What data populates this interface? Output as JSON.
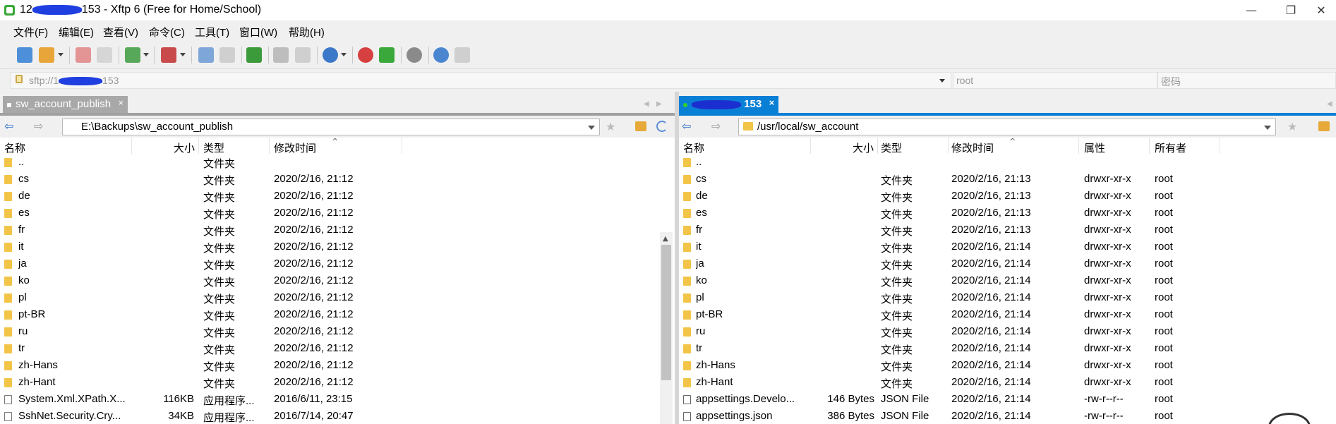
{
  "window": {
    "title_prefix": "12",
    "title_suffix": "153 - Xftp 6 (Free for Home/School)",
    "minimize_glyph": "—",
    "maximize_glyph": "❐",
    "close_glyph": "✕"
  },
  "menu": [
    "文件(F)",
    "编辑(E)",
    "查看(V)",
    "命令(C)",
    "工具(T)",
    "窗口(W)",
    "帮助(H)"
  ],
  "toolbar_icons": [
    "new-session-icon",
    "open-folder-icon",
    "connect-icon",
    "disconnect-icon",
    "new-window-icon",
    "media-icon",
    "sync-icon",
    "copy-icon",
    "transfer-icon",
    "globe-icon",
    "xshell-icon",
    "xftp-icon",
    "settings-icon",
    "help-icon",
    "message-icon"
  ],
  "address": {
    "prefix": "sftp://1",
    "suffix": "153",
    "user_placeholder": "root",
    "password_placeholder": "密码"
  },
  "left": {
    "tab_label": "sw_account_publish",
    "tab_close": "×",
    "path": "E:\\Backups\\sw_account_publish",
    "columns": {
      "name": "名称",
      "size": "大小",
      "type": "类型",
      "modified": "修改时间"
    },
    "rows": [
      {
        "icon": "folder",
        "name": "..",
        "size": "",
        "type": "文件夹",
        "modified": ""
      },
      {
        "icon": "folder",
        "name": "cs",
        "size": "",
        "type": "文件夹",
        "modified": "2020/2/16, 21:12"
      },
      {
        "icon": "folder",
        "name": "de",
        "size": "",
        "type": "文件夹",
        "modified": "2020/2/16, 21:12"
      },
      {
        "icon": "folder",
        "name": "es",
        "size": "",
        "type": "文件夹",
        "modified": "2020/2/16, 21:12"
      },
      {
        "icon": "folder",
        "name": "fr",
        "size": "",
        "type": "文件夹",
        "modified": "2020/2/16, 21:12"
      },
      {
        "icon": "folder",
        "name": "it",
        "size": "",
        "type": "文件夹",
        "modified": "2020/2/16, 21:12"
      },
      {
        "icon": "folder",
        "name": "ja",
        "size": "",
        "type": "文件夹",
        "modified": "2020/2/16, 21:12"
      },
      {
        "icon": "folder",
        "name": "ko",
        "size": "",
        "type": "文件夹",
        "modified": "2020/2/16, 21:12"
      },
      {
        "icon": "folder",
        "name": "pl",
        "size": "",
        "type": "文件夹",
        "modified": "2020/2/16, 21:12"
      },
      {
        "icon": "folder",
        "name": "pt-BR",
        "size": "",
        "type": "文件夹",
        "modified": "2020/2/16, 21:12"
      },
      {
        "icon": "folder",
        "name": "ru",
        "size": "",
        "type": "文件夹",
        "modified": "2020/2/16, 21:12"
      },
      {
        "icon": "folder",
        "name": "tr",
        "size": "",
        "type": "文件夹",
        "modified": "2020/2/16, 21:12"
      },
      {
        "icon": "folder",
        "name": "zh-Hans",
        "size": "",
        "type": "文件夹",
        "modified": "2020/2/16, 21:12"
      },
      {
        "icon": "folder",
        "name": "zh-Hant",
        "size": "",
        "type": "文件夹",
        "modified": "2020/2/16, 21:12"
      },
      {
        "icon": "file",
        "name": "System.Xml.XPath.X...",
        "size": "116KB",
        "type": "应用程序...",
        "modified": "2016/6/11, 23:15"
      },
      {
        "icon": "file",
        "name": "SshNet.Security.Cry...",
        "size": "34KB",
        "type": "应用程序...",
        "modified": "2016/7/14, 20:47"
      }
    ]
  },
  "right": {
    "tab_suffix": "153",
    "tab_close": "×",
    "path": "/usr/local/sw_account",
    "columns": {
      "name": "名称",
      "size": "大小",
      "type": "类型",
      "modified": "修改时间",
      "attr": "属性",
      "owner": "所有者"
    },
    "rows": [
      {
        "icon": "folder",
        "name": "..",
        "size": "",
        "type": "",
        "modified": "",
        "attr": "",
        "owner": ""
      },
      {
        "icon": "folder",
        "name": "cs",
        "size": "",
        "type": "文件夹",
        "modified": "2020/2/16, 21:13",
        "attr": "drwxr-xr-x",
        "owner": "root"
      },
      {
        "icon": "folder",
        "name": "de",
        "size": "",
        "type": "文件夹",
        "modified": "2020/2/16, 21:13",
        "attr": "drwxr-xr-x",
        "owner": "root"
      },
      {
        "icon": "folder",
        "name": "es",
        "size": "",
        "type": "文件夹",
        "modified": "2020/2/16, 21:13",
        "attr": "drwxr-xr-x",
        "owner": "root"
      },
      {
        "icon": "folder",
        "name": "fr",
        "size": "",
        "type": "文件夹",
        "modified": "2020/2/16, 21:13",
        "attr": "drwxr-xr-x",
        "owner": "root"
      },
      {
        "icon": "folder",
        "name": "it",
        "size": "",
        "type": "文件夹",
        "modified": "2020/2/16, 21:14",
        "attr": "drwxr-xr-x",
        "owner": "root"
      },
      {
        "icon": "folder",
        "name": "ja",
        "size": "",
        "type": "文件夹",
        "modified": "2020/2/16, 21:14",
        "attr": "drwxr-xr-x",
        "owner": "root"
      },
      {
        "icon": "folder",
        "name": "ko",
        "size": "",
        "type": "文件夹",
        "modified": "2020/2/16, 21:14",
        "attr": "drwxr-xr-x",
        "owner": "root"
      },
      {
        "icon": "folder",
        "name": "pl",
        "size": "",
        "type": "文件夹",
        "modified": "2020/2/16, 21:14",
        "attr": "drwxr-xr-x",
        "owner": "root"
      },
      {
        "icon": "folder",
        "name": "pt-BR",
        "size": "",
        "type": "文件夹",
        "modified": "2020/2/16, 21:14",
        "attr": "drwxr-xr-x",
        "owner": "root"
      },
      {
        "icon": "folder",
        "name": "ru",
        "size": "",
        "type": "文件夹",
        "modified": "2020/2/16, 21:14",
        "attr": "drwxr-xr-x",
        "owner": "root"
      },
      {
        "icon": "folder",
        "name": "tr",
        "size": "",
        "type": "文件夹",
        "modified": "2020/2/16, 21:14",
        "attr": "drwxr-xr-x",
        "owner": "root"
      },
      {
        "icon": "folder",
        "name": "zh-Hans",
        "size": "",
        "type": "文件夹",
        "modified": "2020/2/16, 21:14",
        "attr": "drwxr-xr-x",
        "owner": "root"
      },
      {
        "icon": "folder",
        "name": "zh-Hant",
        "size": "",
        "type": "文件夹",
        "modified": "2020/2/16, 21:14",
        "attr": "drwxr-xr-x",
        "owner": "root"
      },
      {
        "icon": "json",
        "name": "appsettings.Develo...",
        "size": "146 Bytes",
        "type": "JSON File",
        "modified": "2020/2/16, 21:14",
        "attr": "-rw-r--r--",
        "owner": "root"
      },
      {
        "icon": "json",
        "name": "appsettings.json",
        "size": "386 Bytes",
        "type": "JSON File",
        "modified": "2020/2/16, 21:14",
        "attr": "-rw-r--r--",
        "owner": "root"
      }
    ]
  },
  "colors": {
    "active_tab": "#0a7fd6",
    "inactive_tab": "#a8a8a8",
    "folder": "#f2c548"
  }
}
